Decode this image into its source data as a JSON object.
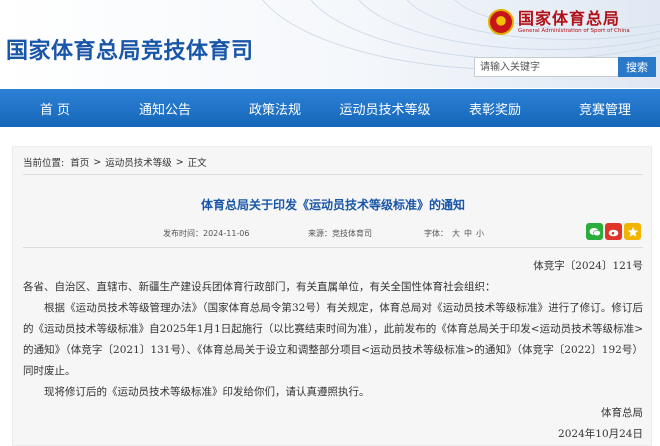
{
  "header": {
    "site_title": "国家体育总局竞技体育司",
    "brand_cn": "国家体育总局",
    "brand_en": "General Administration of Sport of China",
    "search_placeholder": "请输入关键字",
    "search_button": "搜索"
  },
  "nav": [
    "首 页",
    "通知公告",
    "政策法规",
    "运动员技术等级",
    "表彰奖励",
    "竞赛管理"
  ],
  "breadcrumb": {
    "label": "当前位置:",
    "items": [
      "首页",
      "运动员技术等级",
      "正文"
    ],
    "sep": ">"
  },
  "article": {
    "title": "体育总局关于印发《运动员技术等级标准》的通知",
    "publish_time": "发布时间：2024-11-06",
    "source": "来源：竞技体育司",
    "font_label": "字体：",
    "font_sizes": [
      "大",
      "中",
      "小"
    ],
    "doc_number": "体竞字〔2024〕121号",
    "salutation": "各省、自治区、直辖市、新疆生产建设兵团体育行政部门，有关直属单位，有关全国性体育社会组织：",
    "para1": "根据《运动员技术等级管理办法》（国家体育总局令第32号）有关规定，体育总局对《运动员技术等级标准》进行了修订。修订后的《运动员技术等级标准》自2025年1月1日起施行（以比赛结束时间为准），此前发布的《体育总局关于印发<运动员技术等级标准>的通知》（体竞字〔2021〕131号）、《体育总局关于设立和调整部分项目<运动员技术等级标准>的通知》（体竞字〔2022〕192号）同时废止。",
    "para2": "现将修订后的《运动员技术等级标准》印发给你们，请认真遵照执行。",
    "signature": "体育总局",
    "date": "2024年10月24日"
  },
  "share": [
    "wechat-icon",
    "weibo-icon",
    "qzone-icon"
  ],
  "colors": {
    "brand_blue": "#1a56a8",
    "nav_blue": "#1e70c4",
    "brand_red": "#b21016"
  }
}
